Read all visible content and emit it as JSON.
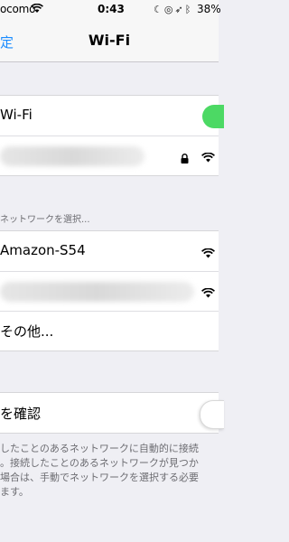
{
  "status_bar": {
    "carrier": "ocomo",
    "time": "0:43",
    "battery": "38%"
  },
  "nav": {
    "back_label": "定",
    "title": "Wi-Fi"
  },
  "wifi": {
    "toggle_label": "Wi-Fi",
    "toggle_on": true
  },
  "section": {
    "choose_network_header": "ネットワークを選択..."
  },
  "networks": [
    {
      "name": "Amazon-S54"
    }
  ],
  "other": {
    "label": "その他..."
  },
  "ask_to_join": {
    "label": "を確認",
    "toggle_on": false
  },
  "footer": {
    "lines": [
      "したことのあるネットワークに自動的に接続",
      "。接続したことのあるネットワークが見つか",
      "場合は、手動でネットワークを選択する必要",
      "ます。"
    ]
  },
  "colors": {
    "accent": "#1a8cff",
    "toggle_on": "#4cd964",
    "background": "#efeff4"
  }
}
